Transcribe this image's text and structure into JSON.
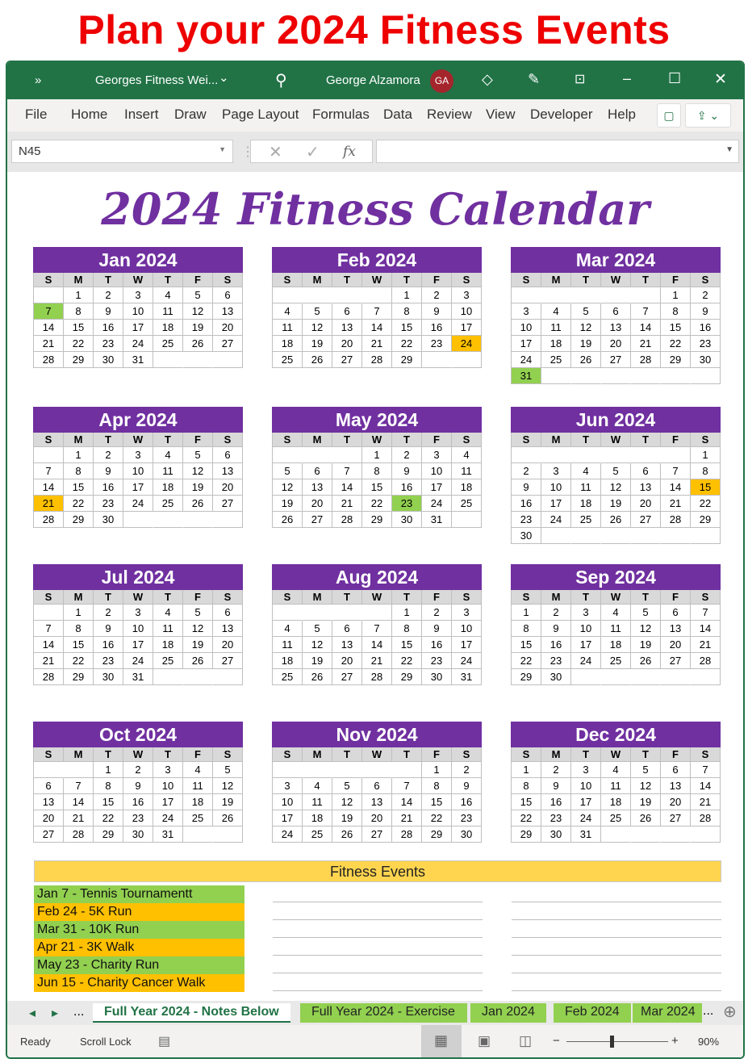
{
  "headline": "Plan your 2024 Fitness Events",
  "window": {
    "chevron": "»",
    "file_title": "Georges Fitness Wei...",
    "file_dropdown": "⌄",
    "user": "George Alzamora",
    "initials": "GA",
    "icons": [
      "search-icon",
      "diamond-icon",
      "pen-icon",
      "restore-icon",
      "minimize-icon",
      "maximize-icon",
      "close-icon"
    ],
    "accent": "#217346"
  },
  "ribbon": {
    "tabs": [
      "File",
      "Home",
      "Insert",
      "Draw",
      "Page Layout",
      "Formulas",
      "Data",
      "Review",
      "View",
      "Developer",
      "Help"
    ],
    "comment_icon": "▢",
    "share_icon": "⇪ ⌄"
  },
  "formula_bar": {
    "name_box": "N45",
    "cancel": "✕",
    "enter": "✓",
    "fx": "fx",
    "value": ""
  },
  "sheet": {
    "title": "2024 Fitness Calendar",
    "weekdays": [
      "S",
      "M",
      "T",
      "W",
      "T",
      "F",
      "S"
    ],
    "highlight_colors": {
      "green": "#92d050",
      "orange": "#ffc000"
    },
    "months": [
      {
        "name": "Jan 2024",
        "highlight": {
          "day": 7,
          "color": "green"
        },
        "weeks": [
          [
            null,
            1,
            2,
            3,
            4,
            5,
            6
          ],
          [
            7,
            8,
            9,
            10,
            11,
            12,
            13
          ],
          [
            14,
            15,
            16,
            17,
            18,
            19,
            20
          ],
          [
            21,
            22,
            23,
            24,
            25,
            26,
            27
          ],
          [
            28,
            29,
            30,
            31,
            null,
            null,
            null
          ]
        ]
      },
      {
        "name": "Feb 2024",
        "highlight": {
          "day": 24,
          "color": "orange"
        },
        "weeks": [
          [
            null,
            null,
            null,
            null,
            1,
            2,
            3
          ],
          [
            4,
            5,
            6,
            7,
            8,
            9,
            10
          ],
          [
            11,
            12,
            13,
            14,
            15,
            16,
            17
          ],
          [
            18,
            19,
            20,
            21,
            22,
            23,
            24
          ],
          [
            25,
            26,
            27,
            28,
            29,
            null,
            null
          ]
        ]
      },
      {
        "name": "Mar 2024",
        "highlight": {
          "day": 31,
          "color": "green"
        },
        "weeks": [
          [
            null,
            null,
            null,
            null,
            null,
            1,
            2
          ],
          [
            3,
            4,
            5,
            6,
            7,
            8,
            9
          ],
          [
            10,
            11,
            12,
            13,
            14,
            15,
            16
          ],
          [
            17,
            18,
            19,
            20,
            21,
            22,
            23
          ],
          [
            24,
            25,
            26,
            27,
            28,
            29,
            30
          ],
          [
            31,
            null,
            null,
            null,
            null,
            null,
            null
          ]
        ]
      },
      {
        "name": "Apr 2024",
        "highlight": {
          "day": 21,
          "color": "orange"
        },
        "weeks": [
          [
            null,
            1,
            2,
            3,
            4,
            5,
            6
          ],
          [
            7,
            8,
            9,
            10,
            11,
            12,
            13
          ],
          [
            14,
            15,
            16,
            17,
            18,
            19,
            20
          ],
          [
            21,
            22,
            23,
            24,
            25,
            26,
            27
          ],
          [
            28,
            29,
            30,
            null,
            null,
            null,
            null
          ]
        ]
      },
      {
        "name": "May 2024",
        "highlight": {
          "day": 23,
          "color": "green"
        },
        "weeks": [
          [
            null,
            null,
            null,
            1,
            2,
            3,
            4
          ],
          [
            5,
            6,
            7,
            8,
            9,
            10,
            11
          ],
          [
            12,
            13,
            14,
            15,
            16,
            17,
            18
          ],
          [
            19,
            20,
            21,
            22,
            23,
            24,
            25
          ],
          [
            26,
            27,
            28,
            29,
            30,
            31,
            null
          ]
        ]
      },
      {
        "name": "Jun 2024",
        "highlight": {
          "day": 15,
          "color": "orange"
        },
        "weeks": [
          [
            null,
            null,
            null,
            null,
            null,
            null,
            1
          ],
          [
            2,
            3,
            4,
            5,
            6,
            7,
            8
          ],
          [
            9,
            10,
            11,
            12,
            13,
            14,
            15
          ],
          [
            16,
            17,
            18,
            19,
            20,
            21,
            22
          ],
          [
            23,
            24,
            25,
            26,
            27,
            28,
            29
          ],
          [
            30,
            null,
            null,
            null,
            null,
            null,
            null
          ]
        ]
      },
      {
        "name": "Jul 2024",
        "weeks": [
          [
            null,
            1,
            2,
            3,
            4,
            5,
            6
          ],
          [
            7,
            8,
            9,
            10,
            11,
            12,
            13
          ],
          [
            14,
            15,
            16,
            17,
            18,
            19,
            20
          ],
          [
            21,
            22,
            23,
            24,
            25,
            26,
            27
          ],
          [
            28,
            29,
            30,
            31,
            null,
            null,
            null
          ]
        ]
      },
      {
        "name": "Aug 2024",
        "weeks": [
          [
            null,
            null,
            null,
            null,
            1,
            2,
            3
          ],
          [
            4,
            5,
            6,
            7,
            8,
            9,
            10
          ],
          [
            11,
            12,
            13,
            14,
            15,
            16,
            17
          ],
          [
            18,
            19,
            20,
            21,
            22,
            23,
            24
          ],
          [
            25,
            26,
            27,
            28,
            29,
            30,
            31
          ]
        ]
      },
      {
        "name": "Sep 2024",
        "weeks": [
          [
            1,
            2,
            3,
            4,
            5,
            6,
            7
          ],
          [
            8,
            9,
            10,
            11,
            12,
            13,
            14
          ],
          [
            15,
            16,
            17,
            18,
            19,
            20,
            21
          ],
          [
            22,
            23,
            24,
            25,
            26,
            27,
            28
          ],
          [
            29,
            30,
            null,
            null,
            null,
            null,
            null
          ]
        ]
      },
      {
        "name": "Oct 2024",
        "weeks": [
          [
            null,
            null,
            1,
            2,
            3,
            4,
            5
          ],
          [
            6,
            7,
            8,
            9,
            10,
            11,
            12
          ],
          [
            13,
            14,
            15,
            16,
            17,
            18,
            19
          ],
          [
            20,
            21,
            22,
            23,
            24,
            25,
            26
          ],
          [
            27,
            28,
            29,
            30,
            31,
            null,
            null
          ]
        ]
      },
      {
        "name": "Nov 2024",
        "weeks": [
          [
            null,
            null,
            null,
            null,
            null,
            1,
            2
          ],
          [
            3,
            4,
            5,
            6,
            7,
            8,
            9
          ],
          [
            10,
            11,
            12,
            13,
            14,
            15,
            16
          ],
          [
            17,
            18,
            19,
            20,
            21,
            22,
            23
          ],
          [
            24,
            25,
            26,
            27,
            28,
            29,
            30
          ]
        ]
      },
      {
        "name": "Dec 2024",
        "weeks": [
          [
            1,
            2,
            3,
            4,
            5,
            6,
            7
          ],
          [
            8,
            9,
            10,
            11,
            12,
            13,
            14
          ],
          [
            15,
            16,
            17,
            18,
            19,
            20,
            21
          ],
          [
            22,
            23,
            24,
            25,
            26,
            27,
            28
          ],
          [
            29,
            30,
            31,
            null,
            null,
            null,
            null
          ]
        ]
      }
    ],
    "events_title": "Fitness Events",
    "events": [
      {
        "text": "Jan 7 - Tennis Tournamentt",
        "color": "green"
      },
      {
        "text": "Feb 24 - 5K Run",
        "color": "orange"
      },
      {
        "text": "Mar 31 - 10K Run",
        "color": "green"
      },
      {
        "text": "Apr 21 - 3K Walk",
        "color": "orange"
      },
      {
        "text": "May 23 - Charity Run",
        "color": "green"
      },
      {
        "text": "Jun 15 - Charity Cancer Walk",
        "color": "orange"
      }
    ]
  },
  "sheet_tabs": {
    "prev": "◂",
    "next": "▸",
    "more_left": "...",
    "tabs": [
      "Full Year 2024 - Notes Below",
      "Full Year 2024 - Exercise",
      "Jan 2024",
      "Feb 2024",
      "Mar 2024"
    ],
    "active": 0,
    "more_right": "...",
    "add": "⊕"
  },
  "status": {
    "ready": "Ready",
    "scroll_lock": "Scroll Lock",
    "zoom_minus": "−",
    "zoom_plus": "+",
    "zoom": "90%",
    "zoom_percent": 90
  }
}
